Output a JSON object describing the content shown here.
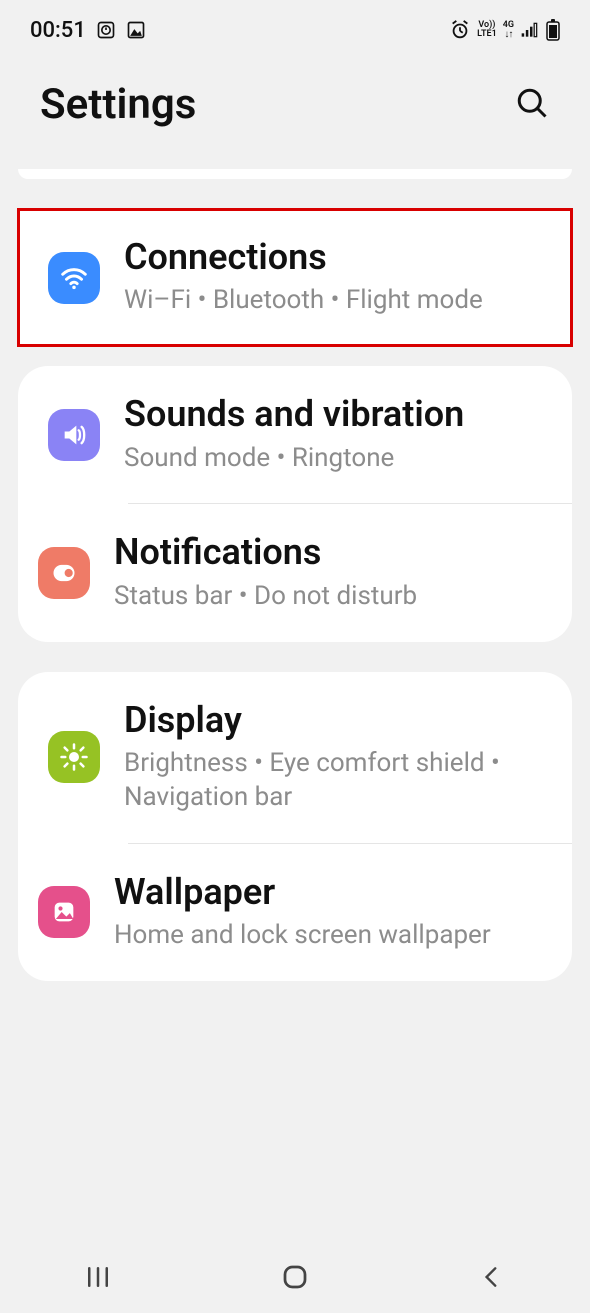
{
  "status": {
    "time": "00:51",
    "volte": "Vo))",
    "lte": "LTE1",
    "net": "4G"
  },
  "header": {
    "title": "Settings"
  },
  "groups": [
    {
      "highlighted": true,
      "items": [
        {
          "key": "connections",
          "title": "Connections",
          "sub": "Wi–Fi  •  Bluetooth  •  Flight mode",
          "icon": "wifi",
          "color": "ic-blue"
        }
      ]
    },
    {
      "items": [
        {
          "key": "sounds",
          "title": "Sounds and vibration",
          "sub": "Sound mode  •  Ringtone",
          "icon": "speaker",
          "color": "ic-purple"
        },
        {
          "key": "notifications",
          "title": "Notifications",
          "sub": "Status bar  •  Do not disturb",
          "icon": "notif",
          "color": "ic-coral"
        }
      ]
    },
    {
      "items": [
        {
          "key": "display",
          "title": "Display",
          "sub": "Brightness  •  Eye comfort shield  •  Navigation bar",
          "icon": "sun",
          "color": "ic-green"
        },
        {
          "key": "wallpaper",
          "title": "Wallpaper",
          "sub": "Home and lock screen wallpaper",
          "icon": "picture",
          "color": "ic-pink"
        }
      ]
    }
  ]
}
